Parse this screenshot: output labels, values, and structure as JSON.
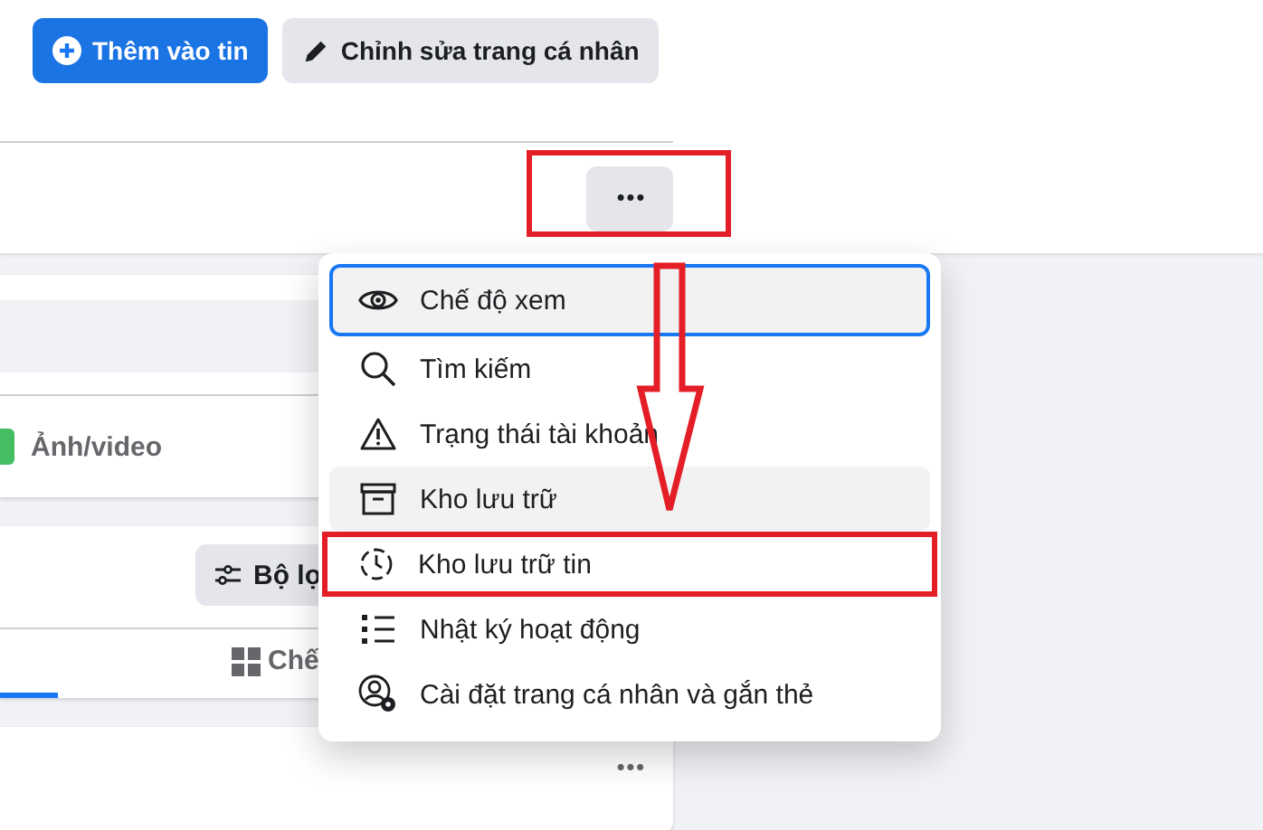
{
  "profile_actions": [
    {
      "kind": "primary",
      "label": "Thêm vào tin"
    },
    {
      "kind": "secondary",
      "label": "Chỉnh sửa trang cá nhân"
    }
  ],
  "more_button": {
    "label": "•••",
    "highlighted": true
  },
  "composer": {
    "media_label": "Ảnh/video"
  },
  "posts_card": {
    "filter_label": "Bộ lọ",
    "tabs": [
      {
        "selected": true
      },
      {
        "label": "Chế",
        "selected": false
      }
    ]
  },
  "post_more": "•••",
  "menu": {
    "items": [
      {
        "label": "Chế độ xem",
        "focused": true,
        "hovered": false,
        "highlighted": false
      },
      {
        "label": "Tìm kiếm",
        "focused": false,
        "hovered": false,
        "highlighted": false
      },
      {
        "label": "Trạng thái tài khoản",
        "focused": false,
        "hovered": false,
        "highlighted": false
      },
      {
        "label": "Kho lưu trữ",
        "focused": false,
        "hovered": true,
        "highlighted": false
      },
      {
        "label": "Kho lưu trữ tin",
        "focused": false,
        "hovered": false,
        "highlighted": true
      },
      {
        "label": "Nhật ký hoạt động",
        "focused": false,
        "hovered": false,
        "highlighted": false
      },
      {
        "label": "Cài đặt trang cá nhân và gắn thẻ",
        "focused": false,
        "hovered": false,
        "highlighted": false
      }
    ]
  },
  "annotation": {
    "arrow": true
  }
}
